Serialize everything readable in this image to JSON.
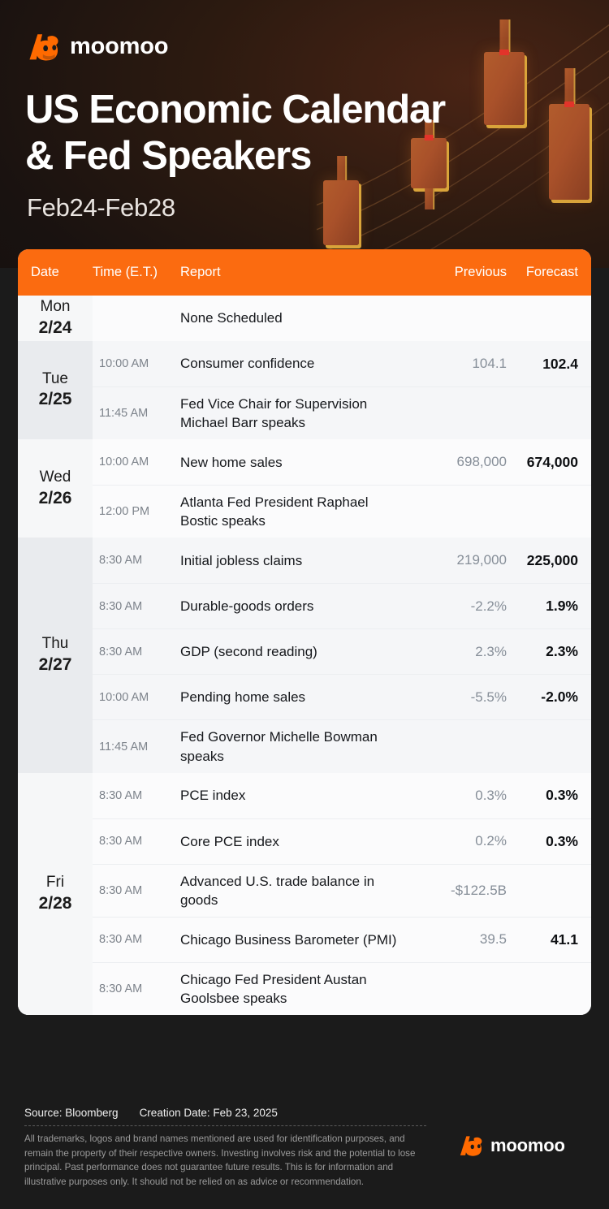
{
  "brand": {
    "name": "moomoo",
    "accent": "#fb6b10",
    "logo_icon": "moomoo-bull-icon"
  },
  "hero": {
    "title": "US Economic Calendar & Fed Speakers",
    "title_line1": "US Economic Calendar",
    "title_line2": "& Fed Speakers",
    "subtitle": "Feb24-Feb28"
  },
  "table": {
    "columns": {
      "date": "Date",
      "time": "Time (E.T.)",
      "report": "Report",
      "previous": "Previous",
      "forecast": "Forecast"
    },
    "days": [
      {
        "dow": "Mon",
        "date": "2/24",
        "rows": [
          {
            "time": "",
            "report": "None Scheduled",
            "previous": "",
            "forecast": ""
          }
        ]
      },
      {
        "dow": "Tue",
        "date": "2/25",
        "rows": [
          {
            "time": "10:00 AM",
            "report": "Consumer confidence",
            "previous": "104.1",
            "forecast": "102.4"
          },
          {
            "time": "11:45 AM",
            "report": "Fed Vice Chair for Supervision Michael Barr speaks",
            "previous": "",
            "forecast": ""
          }
        ]
      },
      {
        "dow": "Wed",
        "date": "2/26",
        "rows": [
          {
            "time": "10:00 AM",
            "report": "New home sales",
            "previous": "698,000",
            "forecast": "674,000"
          },
          {
            "time": "12:00 PM",
            "report": "Atlanta Fed President Raphael Bostic speaks",
            "previous": "",
            "forecast": ""
          }
        ]
      },
      {
        "dow": "Thu",
        "date": "2/27",
        "rows": [
          {
            "time": "8:30 AM",
            "report": "Initial jobless claims",
            "previous": "219,000",
            "forecast": "225,000"
          },
          {
            "time": "8:30 AM",
            "report": "Durable-goods orders",
            "previous": "-2.2%",
            "forecast": "1.9%"
          },
          {
            "time": "8:30 AM",
            "report": "GDP (second reading)",
            "previous": "2.3%",
            "forecast": "2.3%"
          },
          {
            "time": "10:00 AM",
            "report": "Pending home sales",
            "previous": "-5.5%",
            "forecast": "-2.0%"
          },
          {
            "time": "11:45 AM",
            "report": "Fed Governor Michelle Bowman speaks",
            "previous": "",
            "forecast": ""
          }
        ]
      },
      {
        "dow": "Fri",
        "date": "2/28",
        "rows": [
          {
            "time": "8:30 AM",
            "report": "PCE index",
            "previous": "0.3%",
            "forecast": "0.3%"
          },
          {
            "time": "8:30 AM",
            "report": "Core PCE index",
            "previous": "0.2%",
            "forecast": "0.3%"
          },
          {
            "time": "8:30 AM",
            "report": "Advanced U.S. trade balance in goods",
            "previous": "-$122.5B",
            "forecast": ""
          },
          {
            "time": "8:30 AM",
            "report": "Chicago Business Barometer (PMI)",
            "previous": "39.5",
            "forecast": "41.1"
          },
          {
            "time": "8:30 AM",
            "report": "Chicago Fed President Austan Goolsbee speaks",
            "previous": "",
            "forecast": ""
          }
        ]
      }
    ]
  },
  "footer": {
    "source": "Source: Bloomberg",
    "creation_date": "Creation Date: Feb 23, 2025",
    "disclaimer": "All trademarks, logos and brand names mentioned are used for identification purposes, and remain the property of their respective owners. Investing involves risk and the potential to lose principal. Past performance does not guarantee future results. This is for information and illustrative purposes only. It should not be relied on as advice or recommendation.",
    "logo_word": "moomoo"
  }
}
